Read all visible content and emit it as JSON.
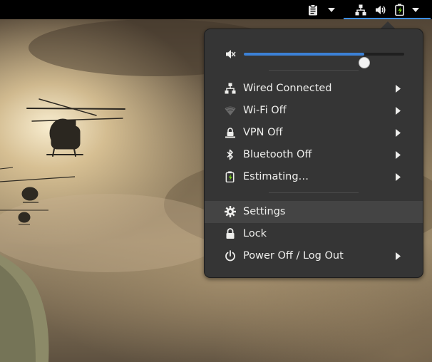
{
  "topbar": {
    "clipboard_icon": "clipboard-icon",
    "system_icons": [
      "network-wired-icon",
      "volume-high-icon",
      "battery-charging-icon"
    ],
    "accent_color": "#3d8ee3"
  },
  "system_menu": {
    "volume": {
      "icon": "volume-muted-icon",
      "level": 0.75
    },
    "items": [
      {
        "label": "Wired Connected",
        "icon": "network-wired-icon",
        "submenu": true
      },
      {
        "label": "Wi-Fi Off",
        "icon": "wifi-off-icon",
        "submenu": true
      },
      {
        "label": "VPN Off",
        "icon": "vpn-icon",
        "submenu": true
      },
      {
        "label": "Bluetooth Off",
        "icon": "bluetooth-icon",
        "submenu": true
      },
      {
        "label": "Estimating…",
        "icon": "battery-charging-icon",
        "submenu": true
      }
    ],
    "actions": [
      {
        "label": "Settings",
        "icon": "gear-icon",
        "highlighted": true
      },
      {
        "label": "Lock",
        "icon": "lock-icon"
      },
      {
        "label": "Power Off / Log Out",
        "icon": "power-icon",
        "submenu": true
      }
    ]
  }
}
